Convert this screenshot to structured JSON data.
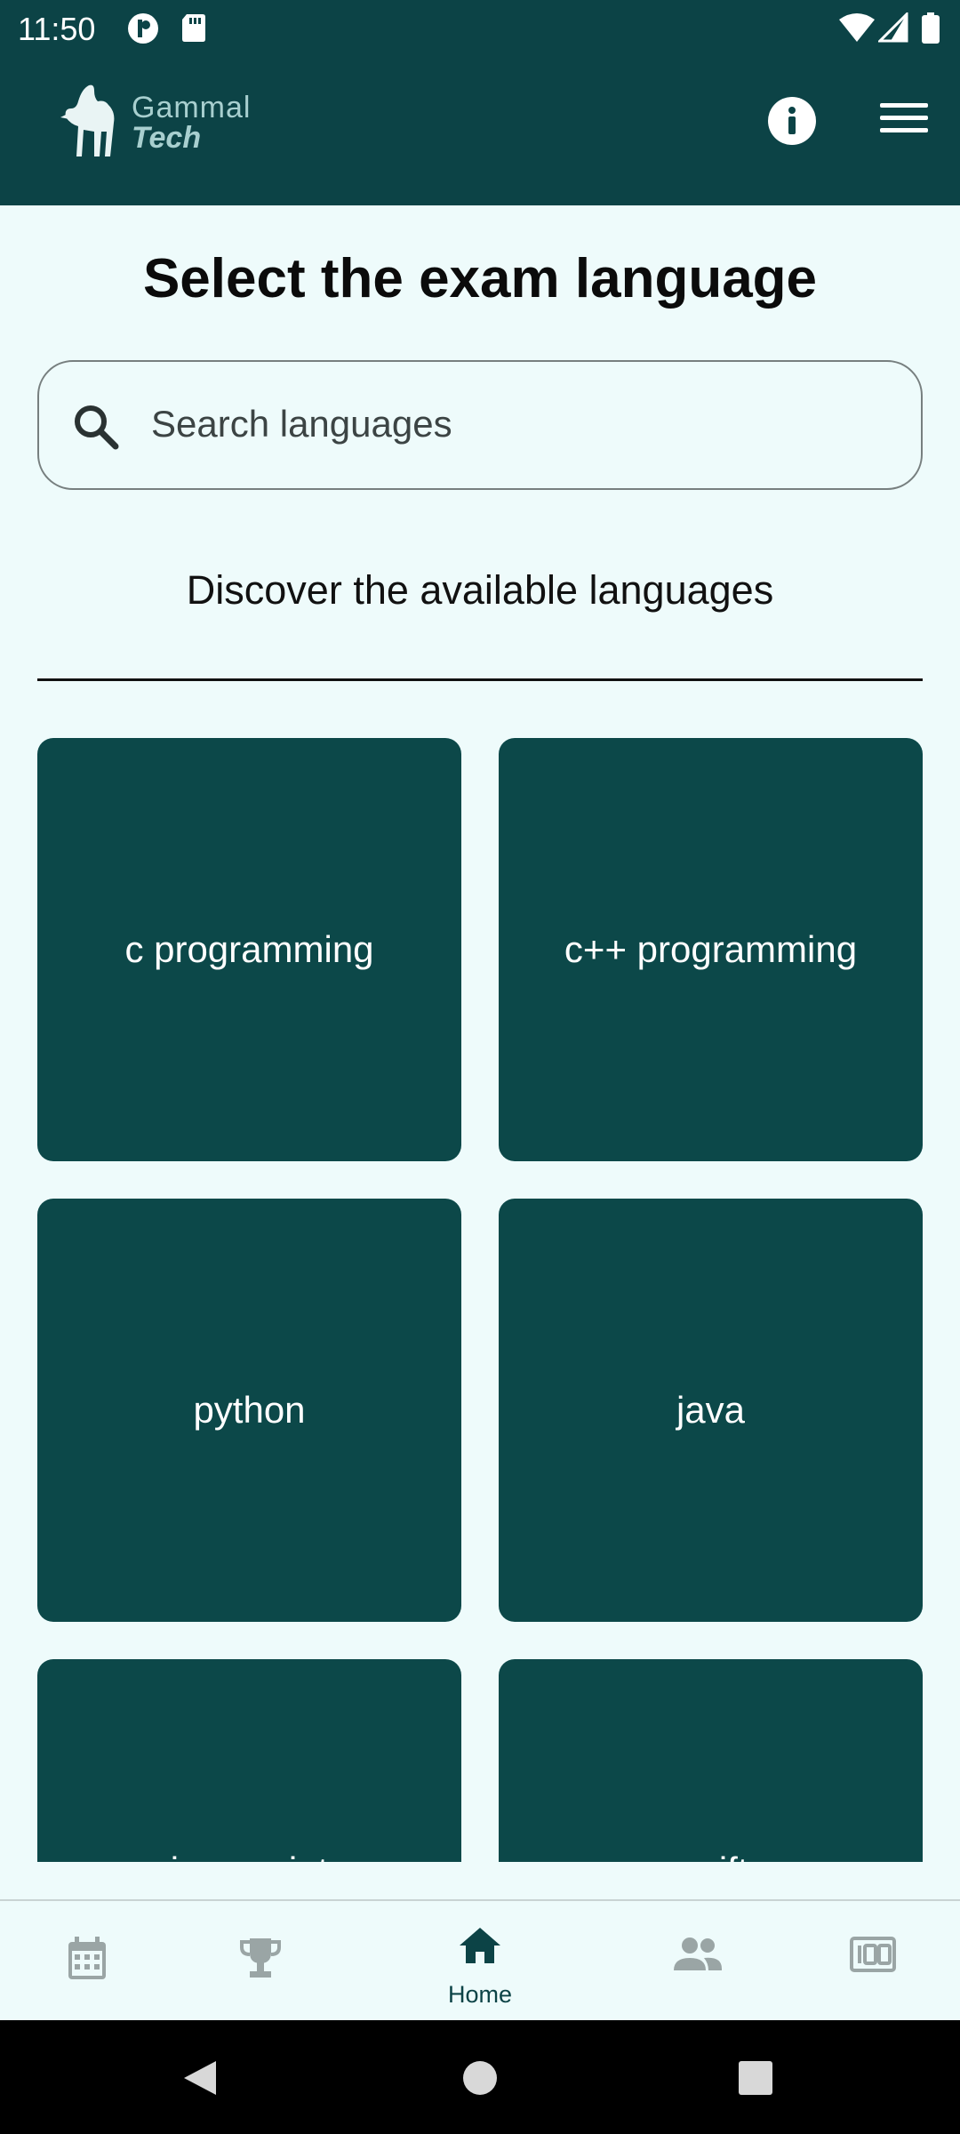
{
  "status_bar": {
    "time": "11:50"
  },
  "app_bar": {
    "brand_line1": "Gammal",
    "brand_line2": "Tech",
    "info_icon": "info-icon",
    "menu_icon": "hamburger-menu-icon"
  },
  "page": {
    "title": "Select the exam language",
    "search_placeholder": "Search languages",
    "section_heading": "Discover the available languages"
  },
  "languages": [
    {
      "label": "c programming"
    },
    {
      "label": "c++ programming"
    },
    {
      "label": "python"
    },
    {
      "label": "java"
    },
    {
      "label": "javascript"
    },
    {
      "label": "swift"
    }
  ],
  "bottom_nav": [
    {
      "icon": "calendar-icon",
      "label": ""
    },
    {
      "icon": "trophy-icon",
      "label": ""
    },
    {
      "icon": "home-icon",
      "label": "Home",
      "active": true
    },
    {
      "icon": "people-icon",
      "label": ""
    },
    {
      "icon": "score-100-icon",
      "label": ""
    }
  ],
  "colors": {
    "primary": "#0c4346",
    "tile": "#0c4849",
    "background": "#eefbfb",
    "inactive_icon": "#9aa5a5"
  }
}
